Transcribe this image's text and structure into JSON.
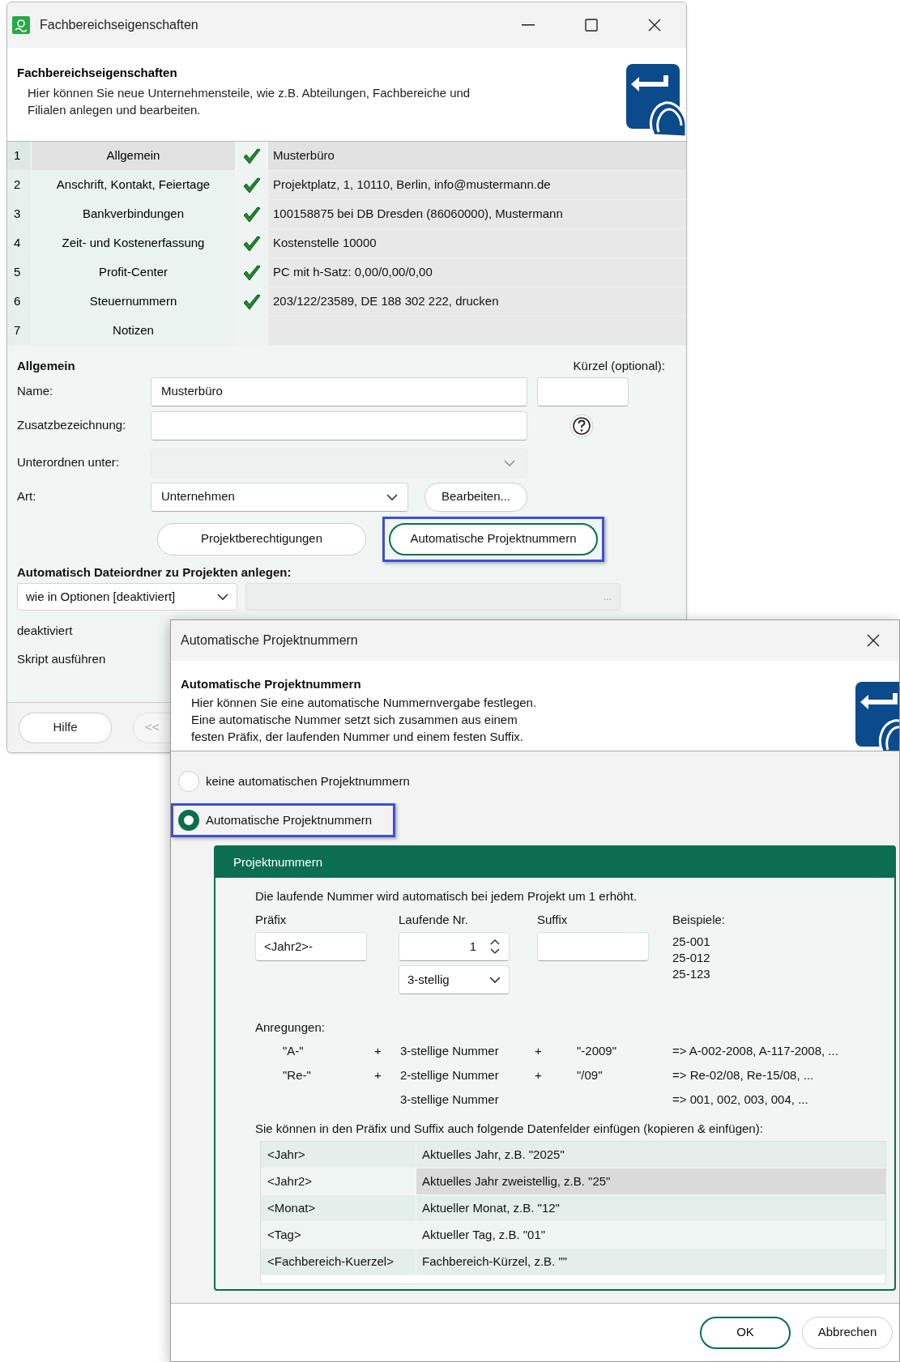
{
  "main_window": {
    "title": "Fachbereichseigenschaften",
    "header": {
      "title": "Fachbereichseigenschaften",
      "description": "Hier können Sie neue Unternehmensteile, wie z.B. Abteilungen, Fachbereiche und Filialen anlegen und bearbeiten."
    },
    "steps": [
      {
        "number": "1",
        "label": "Allgemein",
        "done": true,
        "summary": "Musterbüro",
        "selected": true
      },
      {
        "number": "2",
        "label": "Anschrift, Kontakt, Feiertage",
        "done": true,
        "summary": "Projektplatz, 1, 10110, Berlin, info@mustermann.de",
        "selected": false
      },
      {
        "number": "3",
        "label": "Bankverbindungen",
        "done": true,
        "summary": "100158875 bei DB Dresden (86060000), Mustermann",
        "selected": false
      },
      {
        "number": "4",
        "label": "Zeit- und Kostenerfassung",
        "done": true,
        "summary": "Kostenstelle 10000",
        "selected": false
      },
      {
        "number": "5",
        "label": "Profit-Center",
        "done": true,
        "summary": "PC mit h-Satz: 0,00/0,00/0,00",
        "selected": false
      },
      {
        "number": "6",
        "label": "Steuernummern",
        "done": true,
        "summary": "203/122/23589, DE 188 302 222, drucken",
        "selected": false
      },
      {
        "number": "7",
        "label": "Notizen",
        "done": false,
        "selected": false
      }
    ],
    "form": {
      "section_title": "Allgemein",
      "kuerzel_label": "Kürzel (optional):",
      "name": {
        "label": "Name:",
        "value": "Musterbüro"
      },
      "zusatz": {
        "label": "Zusatzbezeichnung:"
      },
      "unterordnen": {
        "label": "Unterordnen unter:",
        "disabled": true
      },
      "art": {
        "label": "Art:",
        "value": "Unternehmen"
      },
      "edit_button": "Bearbeiten...",
      "buttons": [
        {
          "label": "Projektberechtigungen",
          "highlighted": false
        },
        {
          "label": "Automatische Projektnummern",
          "highlighted": true
        }
      ],
      "folder_title": "Automatisch Dateiordner zu Projekten anlegen:",
      "folder_option": "wie in Optionen [deaktiviert]",
      "browse_button": "...",
      "folder_status": "deaktiviert",
      "script_label": "Skript ausführen"
    },
    "footer_buttons": [
      "Hilfe",
      "<<"
    ]
  },
  "dialog": {
    "title": "Automatische Projektnummern",
    "header": {
      "title": "Automatische Projektnummern",
      "description_lines": [
        "Hier können Sie eine automatische Nummernvergabe festlegen.",
        "Eine automatische Nummer setzt sich zusammen aus einem",
        "festen Präfix, der laufenden Nummer und einem festen Suffix."
      ]
    },
    "options": [
      {
        "label": "keine automatischen Projektnummern",
        "selected": false,
        "highlighted": false
      },
      {
        "label": "Automatische Projektnummern",
        "selected": true,
        "highlighted": true
      }
    ],
    "group": {
      "title": "Projektnummern",
      "intro": "Die laufende Nummer wird automatisch bei jedem Projekt um 1 erhöht.",
      "prefix": {
        "label": "Präfix",
        "value": "<Jahr2>-"
      },
      "counter": {
        "label": "Laufende Nr.",
        "value": "1",
        "digits": "3-stellig"
      },
      "suffix": {
        "label": "Suffix"
      },
      "examples_label": "Beispiele:",
      "examples": [
        "25-001",
        "25-012",
        "25-123"
      ],
      "suggestions_label": "Anregungen:",
      "suggestions": [
        {
          "prefix": "\"A-\"",
          "plus1": "+",
          "digits": "3-stellige Nummer",
          "plus2": "+",
          "suffix": "\"-2009\"",
          "result": "=> A-002-2008,  A-117-2008, ..."
        },
        {
          "prefix": "\"Re-\"",
          "plus1": "+",
          "digits": "2-stellige Nummer",
          "plus2": "+",
          "suffix": "\"/09\"",
          "result": "=> Re-02/08,  Re-15/08, ..."
        },
        {
          "digits": "3-stellige Nummer",
          "result": "=> 001, 002, 003, 004, ..."
        }
      ],
      "fields_intro": "Sie können in den Präfix und Suffix auch folgende Datenfelder einfügen (kopieren & einfügen):",
      "fields": [
        {
          "field": "<Jahr>",
          "description": "Aktuelles Jahr, z.B. \"2025\"",
          "selected": false
        },
        {
          "field": "<Jahr2>",
          "description": "Aktuelles Jahr zweistellig, z.B. \"25\"",
          "selected": true
        },
        {
          "field": "<Monat>",
          "description": "Aktueller Monat, z.B. \"12\"",
          "selected": false
        },
        {
          "field": "<Tag>",
          "description": "Aktueller Tag, z.B. \"01\"",
          "selected": false
        },
        {
          "field": "<Fachbereich-Kuerzel>",
          "description": "Fachbereich-Kürzel, z.B. \"\"",
          "selected": false
        }
      ]
    },
    "buttons": [
      {
        "label": "OK",
        "default": true
      },
      {
        "label": "Abbrechen",
        "default": false
      }
    ]
  }
}
